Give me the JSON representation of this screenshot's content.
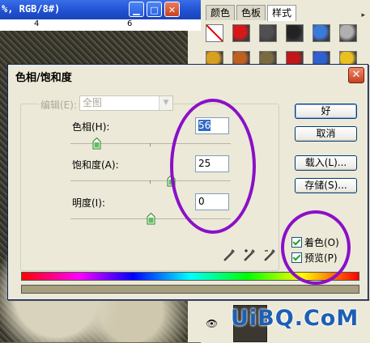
{
  "doc_window": {
    "title": "%, RGB/8#)",
    "ruler_numbers": [
      "4",
      "6"
    ]
  },
  "palette": {
    "tabs": [
      {
        "label": "颜色"
      },
      {
        "label": "色板"
      },
      {
        "label": "样式"
      }
    ],
    "swatch_colors": [
      "#ffffff",
      "#d81818",
      "#505050",
      "#222222",
      "#3a7ad8",
      "#b0b0b0",
      "#d8a020",
      "#c06020",
      "#7a6a40",
      "#c01818",
      "#3060d0",
      "#e8c020"
    ]
  },
  "watermark": "UiBQ.CoM",
  "dialog": {
    "title": "色相/饱和度",
    "close_glyph": "✕",
    "edit": {
      "label": "编辑(E):",
      "value": "全图"
    },
    "hue": {
      "label": "色相(H):",
      "value": "56",
      "level_fraction": 0.16
    },
    "saturation": {
      "label": "饱和度(A):",
      "value": "25",
      "level_fraction": 0.625
    },
    "lightness": {
      "label": "明度(I):",
      "value": "0",
      "level_fraction": 0.5
    },
    "buttons": {
      "ok": "好",
      "cancel": "取消",
      "load": "载入(L)...",
      "save": "存储(S)..."
    },
    "colorize": {
      "label": "着色(O)",
      "checked": true
    },
    "preview": {
      "label": "预览(P)",
      "checked": true
    },
    "result_color": "#a59f7d",
    "annotation_color": "#8a10c8"
  }
}
